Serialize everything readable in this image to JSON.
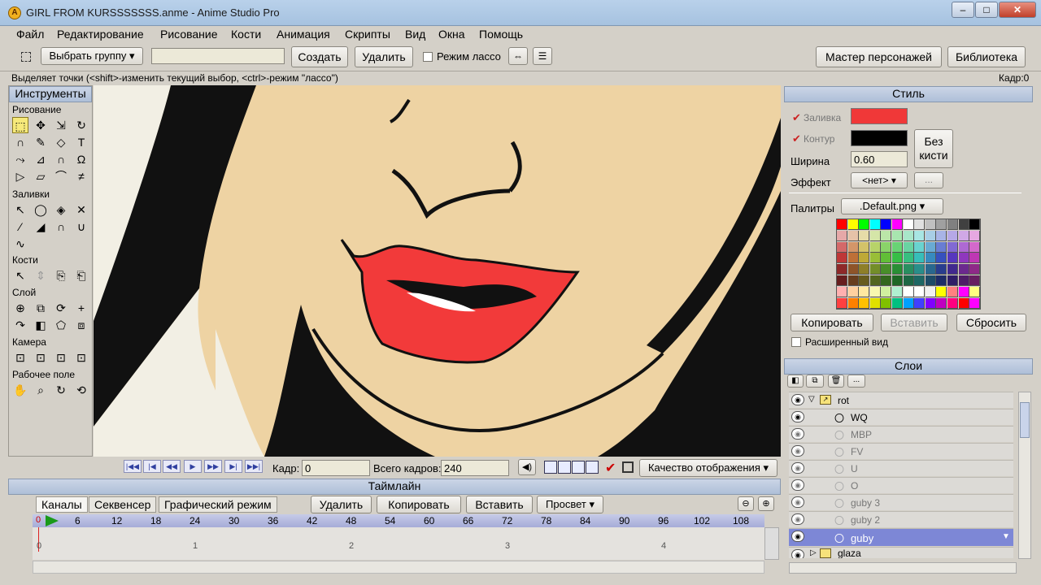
{
  "window": {
    "title": "GIRL FROM KURSSSSSSS.anme - Anime Studio Pro",
    "min": "–",
    "max": "□",
    "close": "✕"
  },
  "menu": [
    "Файл",
    "Редактирование",
    "Рисование",
    "Кости",
    "Анимация",
    "Скрипты",
    "Вид",
    "Окна",
    "Помощь"
  ],
  "toolbar": {
    "select_group": "Выбрать группу",
    "create": "Создать",
    "delete": "Удалить",
    "lasso": "Режим лассо",
    "char_wizard": "Мастер персонажей",
    "library": "Библиотека"
  },
  "status": {
    "hint": "Выделяет точки (<shift>-изменить текущий выбор, <ctrl>-режим \"лассо\")",
    "frame": "Кадр:0"
  },
  "tools": {
    "title": "Инструменты",
    "sections": [
      "Рисование",
      "Заливки",
      "Кости",
      "Слой",
      "Камера",
      "Рабочее поле"
    ]
  },
  "controls": {
    "frame_label": "Кадр:",
    "frame_value": "0",
    "total_label": "Всего кадров:",
    "total_value": "240",
    "quality": "Качество отображения"
  },
  "timeline": {
    "title": "Таймлайн",
    "tabs": [
      "Каналы",
      "Секвенсер",
      "Графический режим"
    ],
    "delete": "Удалить",
    "copy": "Копировать",
    "paste": "Вставить",
    "onion": "Просвет",
    "ticks": [
      "0",
      "6",
      "12",
      "18",
      "24",
      "30",
      "36",
      "42",
      "48",
      "54",
      "60",
      "66",
      "72",
      "78",
      "84",
      "90",
      "96",
      "102",
      "108"
    ],
    "seconds": [
      "0",
      "1",
      "2",
      "3",
      "4"
    ]
  },
  "style": {
    "title": "Стиль",
    "fill_label": "Заливка",
    "stroke_label": "Контур",
    "width_label": "Ширина",
    "width_value": "0.60",
    "effect_label": "Эффект",
    "effect_value": "<нет>",
    "no_brush": "Без кисти",
    "palettes_label": "Палитры",
    "palette_value": ".Default.png",
    "copy": "Копировать",
    "paste": "Вставить",
    "reset": "Сбросить",
    "advanced": "Расширенный вид",
    "fill_color": "#f03838",
    "stroke_color": "#000000"
  },
  "layers": {
    "title": "Слои",
    "items": [
      {
        "name": "rot",
        "type": "group"
      },
      {
        "name": "WQ",
        "type": "vector"
      },
      {
        "name": "MBP",
        "type": "vector"
      },
      {
        "name": "FV",
        "type": "vector"
      },
      {
        "name": "U",
        "type": "vector"
      },
      {
        "name": "O",
        "type": "vector"
      },
      {
        "name": "guby 3",
        "type": "vector"
      },
      {
        "name": "guby 2",
        "type": "vector"
      },
      {
        "name": "guby",
        "type": "vector",
        "selected": true
      },
      {
        "name": "glaza",
        "type": "group"
      }
    ]
  }
}
